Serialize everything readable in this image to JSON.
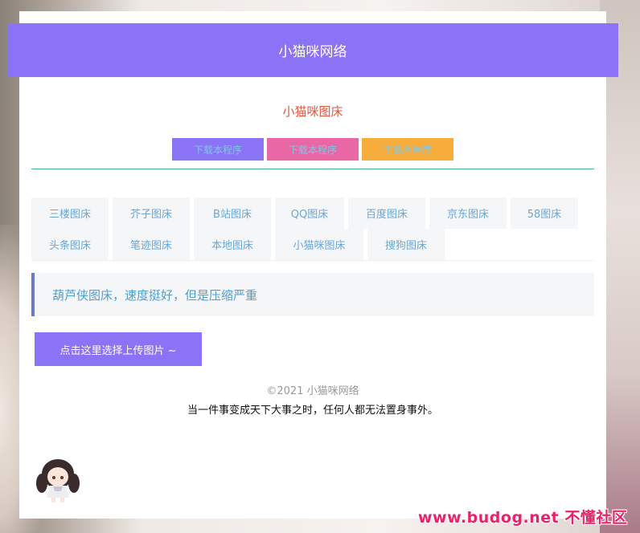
{
  "site": {
    "header_title": "小猫咪网络",
    "subtitle": "小猫咪图床"
  },
  "download_buttons": [
    {
      "label": "下载本程序"
    },
    {
      "label": "下载本程序"
    },
    {
      "label": "下载本程序"
    }
  ],
  "tabs": [
    {
      "label": "三楼图床"
    },
    {
      "label": "芥子图床"
    },
    {
      "label": "B站图床"
    },
    {
      "label": "QQ图床"
    },
    {
      "label": "百度图床"
    },
    {
      "label": "京东图床"
    },
    {
      "label": "58图床"
    },
    {
      "label": "头条图床"
    },
    {
      "label": "笔迹图床"
    },
    {
      "label": "本地图床"
    },
    {
      "label": "小猫咪图床"
    },
    {
      "label": "搜狗图床"
    }
  ],
  "notice": {
    "text": "葫芦侠图床，速度挺好，但是压缩严重"
  },
  "upload": {
    "label": "点击这里选择上传图片 ~"
  },
  "footer": {
    "copyright": "©2021 小猫咪网络",
    "quote": "当一件事变成天下大事之时，任何人都无法置身事外。"
  },
  "watermark": {
    "text": "www.budog.net 不懂社区"
  },
  "colors": {
    "primary": "#8a73f4",
    "pink": "#ea67a6",
    "orange": "#f7ad3c",
    "divider": "#41b995",
    "subtitle": "#e0573e",
    "tab_text": "#6aa7d8",
    "notice_text": "#4d9fd1",
    "notice_border": "#6c79c8"
  }
}
